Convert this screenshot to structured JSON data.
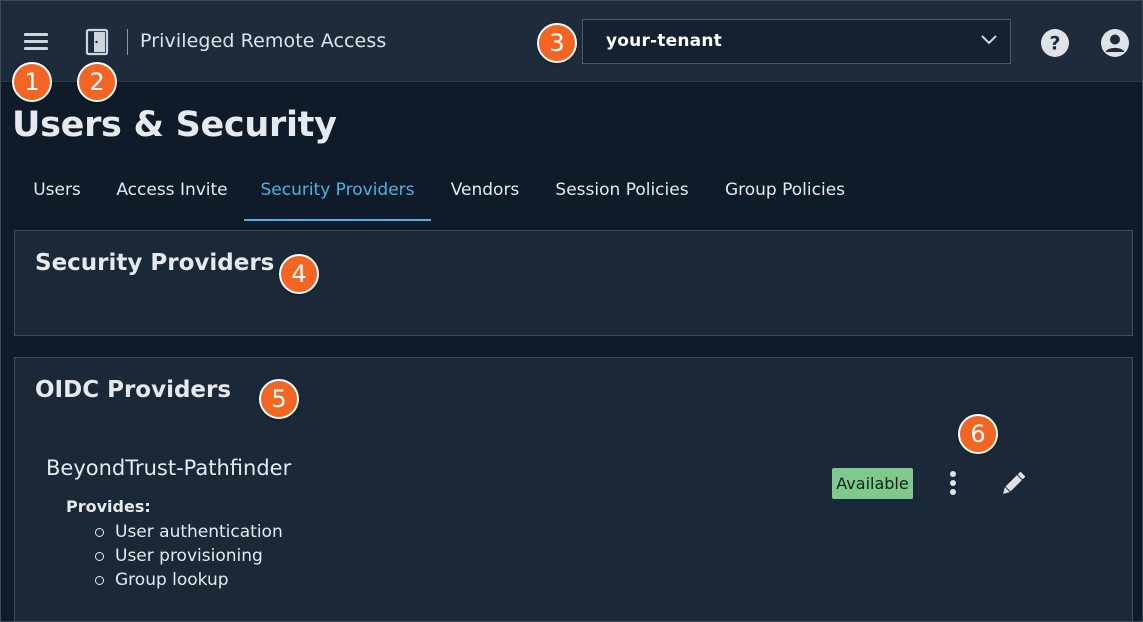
{
  "header": {
    "product_name": "Privileged Remote Access",
    "tenant_selected": "your-tenant",
    "icons": {
      "menu": "hamburger-menu-icon",
      "product": "door-icon",
      "dropdown": "chevron-down-icon",
      "help": "help-circle-icon",
      "user": "user-avatar-icon"
    }
  },
  "callouts": [
    "1",
    "2",
    "3",
    "4",
    "5",
    "6"
  ],
  "page": {
    "title": "Users & Security"
  },
  "tabs": [
    {
      "label": "Users"
    },
    {
      "label": "Access Invite"
    },
    {
      "label": "Security Providers",
      "active": true
    },
    {
      "label": "Vendors"
    },
    {
      "label": "Session Policies"
    },
    {
      "label": "Group Policies"
    }
  ],
  "security_providers_panel": {
    "title": "Security Providers"
  },
  "oidc_panel": {
    "title": "OIDC Providers",
    "provider": {
      "name": "BeyondTrust-Pathfinder",
      "provides_label": "Provides:",
      "provides": [
        "User authentication",
        "User provisioning",
        "Group lookup"
      ],
      "status": "Available",
      "icons": {
        "more": "kebab-menu-icon",
        "edit": "pencil-icon"
      }
    }
  },
  "colors": {
    "topbar_bg": "#1e2b3a",
    "page_bg": "#0f1b29",
    "panel_bg": "#1a2838",
    "accent": "#4ab3e6",
    "callout": "#f26522",
    "status_available": "#7fc98f"
  }
}
